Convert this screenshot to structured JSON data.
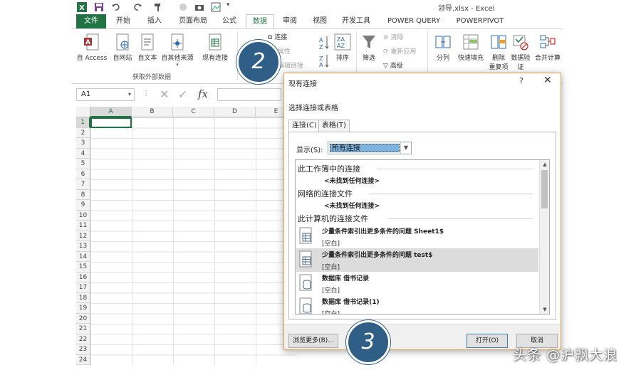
{
  "window": {
    "title": "领导.xlsx - Excel"
  },
  "tabs": [
    "文件",
    "开始",
    "插入",
    "页面布局",
    "公式",
    "数据",
    "审阅",
    "视图",
    "开发工具",
    "POWER QUERY",
    "POWERPIVOT"
  ],
  "active_tab": "数据",
  "ribbon": {
    "get_external": {
      "access": "自 Access",
      "web": "自网站",
      "text": "自文本",
      "other": "自其他来源",
      "existing": "现有连接",
      "group_label": "获取外部数据"
    },
    "connections": {
      "connect": "连接",
      "properties": "属性",
      "edit_links": "编辑链接"
    },
    "sort": {
      "sort": "排序"
    },
    "filter": {
      "filter": "筛选",
      "clear": "清除",
      "reapply": "重新应用",
      "advanced": "高级"
    },
    "data_tools": {
      "text_to_columns": "分列",
      "flash_fill": "快速填充",
      "remove_duplicates_1": "删除",
      "remove_duplicates_2": "重复项",
      "validation_1": "数据验",
      "validation_2": "证",
      "consolidate": "合并计算"
    }
  },
  "formula_bar": {
    "name_box": "A1",
    "fx": "fx"
  },
  "grid": {
    "columns": [
      "A",
      "B",
      "C",
      "D",
      "E"
    ],
    "rows": [
      "1",
      "2",
      "3",
      "4",
      "5",
      "6",
      "7",
      "8",
      "9",
      "10",
      "11",
      "12",
      "13",
      "14",
      "15",
      "16",
      "17",
      "18",
      "19",
      "20",
      "21",
      "22",
      "23",
      "24"
    ]
  },
  "dialog": {
    "title": "现有连接",
    "help": "?",
    "close": "✕",
    "prompt": "选择连接或表格",
    "tab_connections": "连接(C)",
    "tab_tables": "表格(T)",
    "show_label": "显示(S):",
    "show_value": "所有连接",
    "sections": {
      "workbook": "此工作簿中的连接",
      "workbook_none": "<未找到任何连接>",
      "network": "网络的连接文件",
      "network_none": "<未找到任何连接>",
      "computer": "此计算机的连接文件"
    },
    "connections": [
      {
        "name": "少量条件索引出更多条件的问题 Sheet1$",
        "desc": "[空白]",
        "selected": false
      },
      {
        "name": "少量条件索引出更多条件的问题 test$",
        "desc": "[空白]",
        "selected": true
      },
      {
        "name": "数据库 借书记录",
        "desc": "[空白]",
        "selected": false
      },
      {
        "name": "数据库 借书记录(1)",
        "desc": "[空白]",
        "selected": false
      }
    ],
    "browse_button": "浏览更多(B)...",
    "open_button": "打开(O)",
    "cancel_button": "取消"
  },
  "badges": {
    "step2": "2",
    "step3": "3"
  },
  "watermark": "头条 @沪飘大浪",
  "colors": {
    "excel_green": "#217346",
    "badge": "#2f5f86",
    "dialog_border": "#e6a550"
  }
}
